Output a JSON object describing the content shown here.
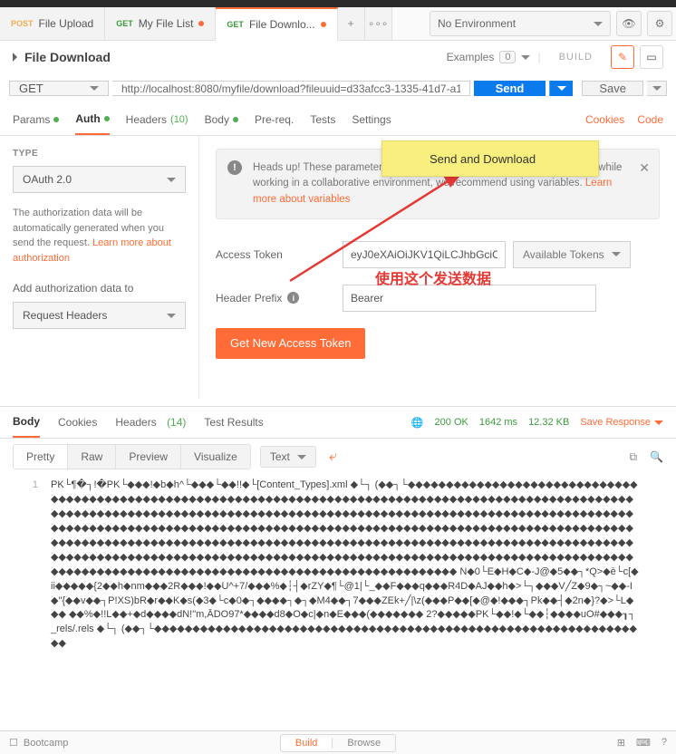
{
  "topEnv": {
    "label": "No Environment"
  },
  "tabs": [
    {
      "method": "POST",
      "methodClass": "post",
      "title": "File Upload",
      "hasDot": false
    },
    {
      "method": "GET",
      "methodClass": "get",
      "title": "My File List",
      "hasDot": true
    },
    {
      "method": "GET",
      "methodClass": "get",
      "title": "File Downlo...",
      "hasDot": true
    }
  ],
  "request": {
    "name": "File Download",
    "method": "GET",
    "url": "http://localhost:8080/myfile/download?fileuuid=d33afcc3-1335-41d7-a1",
    "examplesLabel": "Examples",
    "examplesCount": "0",
    "buildLabel": "BUILD",
    "sendLabel": "Send",
    "saveLabel": "Save",
    "dropdownItem": "Send and Download"
  },
  "reqTabs": {
    "params": "Params",
    "auth": "Auth",
    "headers": "Headers",
    "headersCount": "(10)",
    "body": "Body",
    "prereq": "Pre-req.",
    "tests": "Tests",
    "settings": "Settings",
    "cookies": "Cookies",
    "code": "Code"
  },
  "auth": {
    "typeLabel": "TYPE",
    "typeValue": "OAuth 2.0",
    "desc1": "The authorization data will be automatically generated when you send the request. ",
    "descLink": "Learn more about authorization",
    "addLabel": "Add authorization data to",
    "addValue": "Request Headers",
    "alert": "Heads up! These parameters hold sensitive data. To keep this data secure while working in a collaborative environment, we recommend using variables. ",
    "alertLink": "Learn more about variables",
    "accessTokenLabel": "Access Token",
    "accessTokenValue": "eyJ0eXAiOiJKV1QiLCJhbGciO",
    "availTokens": "Available Tokens",
    "headerPrefixLabel": "Header Prefix",
    "headerPrefixValue": "Bearer",
    "getTokenBtn": "Get New Access Token"
  },
  "annotation": "使用这个发送数据",
  "respTabs": {
    "body": "Body",
    "cookies": "Cookies",
    "headers": "Headers",
    "headersCount": "(14)",
    "testResults": "Test Results",
    "status": "200 OK",
    "time": "1642 ms",
    "size": "12.32 KB",
    "saveResp": "Save Response"
  },
  "respToolbar": {
    "pretty": "Pretty",
    "raw": "Raw",
    "preview": "Preview",
    "visualize": "Visualize",
    "format": "Text"
  },
  "respBody": {
    "lineNo": "1",
    "text": "PK└¶�┐!�PK└◆◆◆!◆b◆h^└◆◆◆└◆◆!!◆└[Content_Types].xml ◆└┐\n(◆◆┐└◆◆◆◆◆◆◆◆◆◆◆◆◆◆◆◆◆◆◆◆◆◆◆◆◆◆◆◆◆◆◆◆◆◆◆◆◆◆◆◆◆◆◆◆◆◆◆◆◆◆◆◆◆◆◆◆◆◆◆◆◆◆◆◆◆◆◆◆◆◆◆◆◆◆◆◆◆◆◆◆◆◆◆◆◆◆◆◆◆◆◆◆◆◆◆◆◆◆◆◆◆◆◆◆◆◆◆◆◆◆◆◆◆◆◆◆◆◆◆◆◆◆◆◆◆◆◆◆◆◆◆◆◆◆◆◆◆◆◆◆◆◆◆◆◆◆◆◆◆◆◆◆◆◆◆◆◆◆◆◆◆◆◆◆◆◆◆◆◆◆◆◆◆◆◆◆◆◆◆◆◆◆◆◆◆◆◆◆◆◆◆◆◆◆◆◆◆◆◆◆◆◆◆◆◆◆◆◆◆◆◆◆◆◆◆◆◆◆◆◆◆◆◆◆◆◆◆◆◆◆◆◆◆◆◆◆◆◆◆◆◆◆◆◆◆◆◆◆◆◆◆◆◆◆◆◆◆◆◆◆◆◆◆◆◆◆◆◆◆◆◆◆◆◆◆◆◆◆◆◆◆◆◆◆◆◆◆◆◆◆◆◆◆◆◆◆◆◆◆◆◆◆◆◆◆◆◆◆◆◆◆◆◆◆◆◆◆◆◆◆◆◆◆◆◆◆◆◆◆◆◆◆◆◆◆◆◆◆◆◆◆◆◆◆◆◆◆◆◆◆◆◆◆◆◆◆◆◆◆◆◆◆◆◆◆◆◆◆◆◆◆◆◆◆◆◆◆◆◆◆◆◆◆◆◆◆◆◆◆◆◆◆◆◆◆◆◆◆◆◆◆◆◆◆◆◆◆◆◆◆◆◆◆◆◆◆◆◆◆◆◆◆◆◆◆◆◆◆◆◆◆◆◆◆◆◆◆◆◆◆◆◆◆◆◆◆◆◆◆◆◆◆◆◆◆◆◆◆◆◆◆◆◆ N◆0└E◆H◆C◆-J@◆5◆◆┐*Q>◆ē└c[◆ii◆◆◆◆◆{2◆◆h◆nm◆◆◆2R◆◆◆!◆◆U^+7/◆◆◆%◆┆┤◆rZY◆¶└@1|└_◆◆F◆◆◆q◆◆◆R4D◆AJ◆◆h◆>└┐◆◆◆V╱Z◆9◆┐~◆◆-I◆\"{◆◆v◆◆┐P!XS)bR◆r◆◆K◆s(◆3◆└c◆0◆┐◆◆◆◆┐◆┐◆M4◆◆┐7◆◆◆ZEk+╱|\\z(◆◆◆P◆◆[◆@◆!◆◆◆┐Pk◆◆┤◆2n◆}?◆>└L◆◆◆ ◆◆%◆!!L◆◆+◆d◆◆◆◆dN!\"m,ĀDO97*◆◆◆◆d8◆O◆c|◆n◆E◆◆◆(◆◆◆◆◆◆◆ 2?◆◆◆◆◆PK└◆◆!◆└◆◆┆◆◆◆◆uO#◆◆◆┒┐_rels/.rels ◆└┐\n(◆◆┐└◆◆◆◆◆◆◆◆◆◆◆◆◆◆◆◆◆◆◆◆◆◆◆◆◆◆◆◆◆◆◆◆◆◆◆◆◆◆◆◆◆◆◆◆◆◆◆◆◆◆◆◆◆◆◆◆◆◆◆◆◆◆◆◆◆"
  },
  "statusBar": {
    "bootcamp": "Bootcamp",
    "build": "Build",
    "browse": "Browse"
  }
}
